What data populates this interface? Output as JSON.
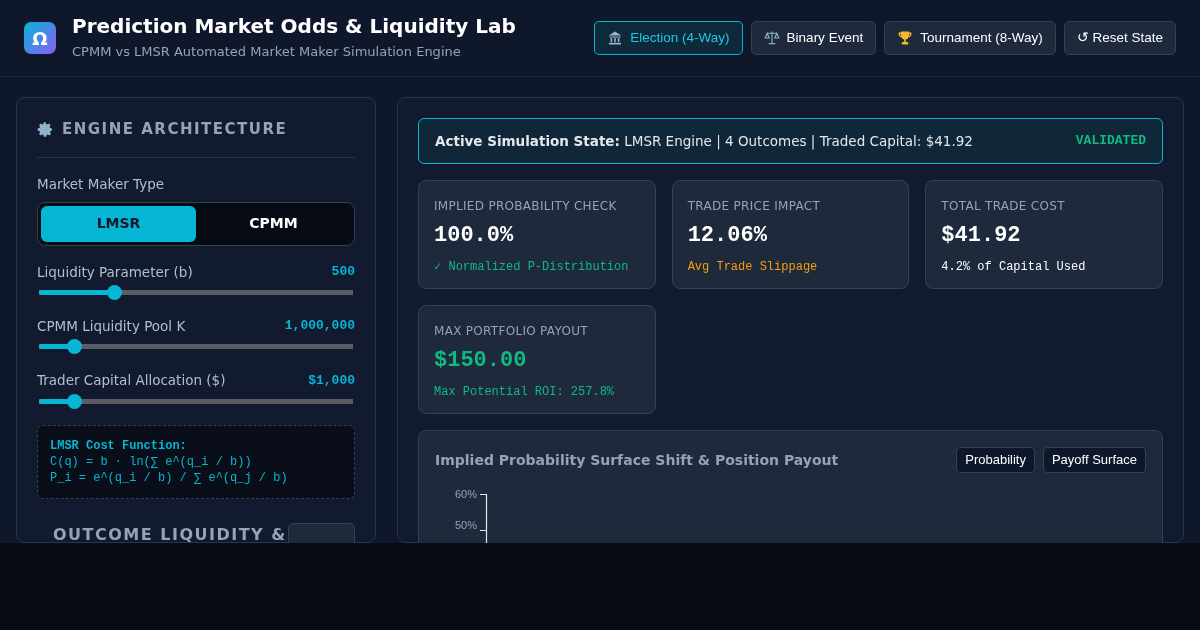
{
  "header": {
    "logo": "Ω",
    "title": "Prediction Market Odds & Liquidity Lab",
    "subtitle": "CPMM vs LMSR Automated Market Maker Simulation Engine"
  },
  "scenarios": [
    {
      "label": "Election (4-Way)",
      "kind": "building",
      "selected": true
    },
    {
      "label": "Binary Event",
      "kind": "scales",
      "selected": false
    },
    {
      "label": "Tournament (8-Way)",
      "kind": "trophy",
      "selected": false
    },
    {
      "label": "↺ Reset State",
      "kind": "reset",
      "selected": false
    }
  ],
  "sidebar": {
    "title": "ENGINE ARCHITECTURE",
    "maker_label": "Market Maker Type",
    "maker_types": [
      {
        "label": "LMSR",
        "selected": true
      },
      {
        "label": "CPMM",
        "selected": false
      }
    ],
    "sliders": [
      {
        "label": "Liquidity Parameter (b)",
        "reading": "500",
        "level": 0.24
      },
      {
        "label": "CPMM Liquidity Pool K",
        "reading": "1,000,000",
        "level": 0.11
      },
      {
        "label": "Trader Capital Allocation ($)",
        "reading": "$1,000",
        "level": 0.11
      }
    ],
    "formula": {
      "title": "LMSR Cost Function:",
      "lines": [
        "C(q) = b · ln(∑ e^(q_i / b))",
        "P_i = e^(q_i / b) / ∑ e^(q_j / b)"
      ]
    },
    "next_section": "OUTCOME LIQUIDITY &"
  },
  "status": {
    "label": "Active Simulation State:",
    "text": "LMSR Engine | 4 Outcomes | Traded Capital: $41.92",
    "badge": "VALIDATED"
  },
  "metrics": [
    {
      "label": "IMPLIED PROBABILITY CHECK",
      "value": "100.0%",
      "note": "✓ Normalized P-Distribution",
      "kind": "good"
    },
    {
      "label": "TRADE PRICE IMPACT",
      "value": "12.06%",
      "note": "Avg Trade Slippage",
      "kind": "warn"
    },
    {
      "label": "TOTAL TRADE COST",
      "value": "$41.92",
      "note": "4.2% of Capital Used",
      "kind": "plain"
    },
    {
      "label": "MAX PORTFOLIO PAYOUT",
      "value": "$150.00",
      "note": "Max Potential ROI: 257.8%",
      "kind": "goodvalue"
    }
  ],
  "chart": {
    "title": "Implied Probability Surface Shift & Position Payout",
    "views": [
      {
        "label": "Probability",
        "selected": false
      },
      {
        "label": "Payoff Surface",
        "selected": false
      }
    ],
    "y_ticks": [
      "60%",
      "50%"
    ]
  }
}
